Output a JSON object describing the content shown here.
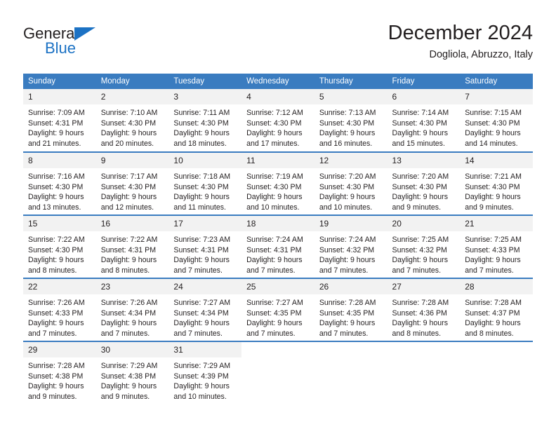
{
  "brand": {
    "name_part1": "General",
    "name_part2": "Blue",
    "accent_color": "#1c72c4"
  },
  "header": {
    "title": "December 2024",
    "subtitle": "Dogliola, Abruzzo, Italy",
    "header_bg_color": "#3a7cc0",
    "day_band_color": "#f2f2f2"
  },
  "weekdays": [
    "Sunday",
    "Monday",
    "Tuesday",
    "Wednesday",
    "Thursday",
    "Friday",
    "Saturday"
  ],
  "labels": {
    "sunrise_prefix": "Sunrise:",
    "sunset_prefix": "Sunset:",
    "daylight_prefix": "Daylight:"
  },
  "weeks": [
    [
      {
        "day": "1",
        "sunrise": "Sunrise: 7:09 AM",
        "sunset": "Sunset: 4:31 PM",
        "daylight_line1": "Daylight: 9 hours",
        "daylight_line2": "and 21 minutes."
      },
      {
        "day": "2",
        "sunrise": "Sunrise: 7:10 AM",
        "sunset": "Sunset: 4:30 PM",
        "daylight_line1": "Daylight: 9 hours",
        "daylight_line2": "and 20 minutes."
      },
      {
        "day": "3",
        "sunrise": "Sunrise: 7:11 AM",
        "sunset": "Sunset: 4:30 PM",
        "daylight_line1": "Daylight: 9 hours",
        "daylight_line2": "and 18 minutes."
      },
      {
        "day": "4",
        "sunrise": "Sunrise: 7:12 AM",
        "sunset": "Sunset: 4:30 PM",
        "daylight_line1": "Daylight: 9 hours",
        "daylight_line2": "and 17 minutes."
      },
      {
        "day": "5",
        "sunrise": "Sunrise: 7:13 AM",
        "sunset": "Sunset: 4:30 PM",
        "daylight_line1": "Daylight: 9 hours",
        "daylight_line2": "and 16 minutes."
      },
      {
        "day": "6",
        "sunrise": "Sunrise: 7:14 AM",
        "sunset": "Sunset: 4:30 PM",
        "daylight_line1": "Daylight: 9 hours",
        "daylight_line2": "and 15 minutes."
      },
      {
        "day": "7",
        "sunrise": "Sunrise: 7:15 AM",
        "sunset": "Sunset: 4:30 PM",
        "daylight_line1": "Daylight: 9 hours",
        "daylight_line2": "and 14 minutes."
      }
    ],
    [
      {
        "day": "8",
        "sunrise": "Sunrise: 7:16 AM",
        "sunset": "Sunset: 4:30 PM",
        "daylight_line1": "Daylight: 9 hours",
        "daylight_line2": "and 13 minutes."
      },
      {
        "day": "9",
        "sunrise": "Sunrise: 7:17 AM",
        "sunset": "Sunset: 4:30 PM",
        "daylight_line1": "Daylight: 9 hours",
        "daylight_line2": "and 12 minutes."
      },
      {
        "day": "10",
        "sunrise": "Sunrise: 7:18 AM",
        "sunset": "Sunset: 4:30 PM",
        "daylight_line1": "Daylight: 9 hours",
        "daylight_line2": "and 11 minutes."
      },
      {
        "day": "11",
        "sunrise": "Sunrise: 7:19 AM",
        "sunset": "Sunset: 4:30 PM",
        "daylight_line1": "Daylight: 9 hours",
        "daylight_line2": "and 10 minutes."
      },
      {
        "day": "12",
        "sunrise": "Sunrise: 7:20 AM",
        "sunset": "Sunset: 4:30 PM",
        "daylight_line1": "Daylight: 9 hours",
        "daylight_line2": "and 10 minutes."
      },
      {
        "day": "13",
        "sunrise": "Sunrise: 7:20 AM",
        "sunset": "Sunset: 4:30 PM",
        "daylight_line1": "Daylight: 9 hours",
        "daylight_line2": "and 9 minutes."
      },
      {
        "day": "14",
        "sunrise": "Sunrise: 7:21 AM",
        "sunset": "Sunset: 4:30 PM",
        "daylight_line1": "Daylight: 9 hours",
        "daylight_line2": "and 9 minutes."
      }
    ],
    [
      {
        "day": "15",
        "sunrise": "Sunrise: 7:22 AM",
        "sunset": "Sunset: 4:30 PM",
        "daylight_line1": "Daylight: 9 hours",
        "daylight_line2": "and 8 minutes."
      },
      {
        "day": "16",
        "sunrise": "Sunrise: 7:22 AM",
        "sunset": "Sunset: 4:31 PM",
        "daylight_line1": "Daylight: 9 hours",
        "daylight_line2": "and 8 minutes."
      },
      {
        "day": "17",
        "sunrise": "Sunrise: 7:23 AM",
        "sunset": "Sunset: 4:31 PM",
        "daylight_line1": "Daylight: 9 hours",
        "daylight_line2": "and 7 minutes."
      },
      {
        "day": "18",
        "sunrise": "Sunrise: 7:24 AM",
        "sunset": "Sunset: 4:31 PM",
        "daylight_line1": "Daylight: 9 hours",
        "daylight_line2": "and 7 minutes."
      },
      {
        "day": "19",
        "sunrise": "Sunrise: 7:24 AM",
        "sunset": "Sunset: 4:32 PM",
        "daylight_line1": "Daylight: 9 hours",
        "daylight_line2": "and 7 minutes."
      },
      {
        "day": "20",
        "sunrise": "Sunrise: 7:25 AM",
        "sunset": "Sunset: 4:32 PM",
        "daylight_line1": "Daylight: 9 hours",
        "daylight_line2": "and 7 minutes."
      },
      {
        "day": "21",
        "sunrise": "Sunrise: 7:25 AM",
        "sunset": "Sunset: 4:33 PM",
        "daylight_line1": "Daylight: 9 hours",
        "daylight_line2": "and 7 minutes."
      }
    ],
    [
      {
        "day": "22",
        "sunrise": "Sunrise: 7:26 AM",
        "sunset": "Sunset: 4:33 PM",
        "daylight_line1": "Daylight: 9 hours",
        "daylight_line2": "and 7 minutes."
      },
      {
        "day": "23",
        "sunrise": "Sunrise: 7:26 AM",
        "sunset": "Sunset: 4:34 PM",
        "daylight_line1": "Daylight: 9 hours",
        "daylight_line2": "and 7 minutes."
      },
      {
        "day": "24",
        "sunrise": "Sunrise: 7:27 AM",
        "sunset": "Sunset: 4:34 PM",
        "daylight_line1": "Daylight: 9 hours",
        "daylight_line2": "and 7 minutes."
      },
      {
        "day": "25",
        "sunrise": "Sunrise: 7:27 AM",
        "sunset": "Sunset: 4:35 PM",
        "daylight_line1": "Daylight: 9 hours",
        "daylight_line2": "and 7 minutes."
      },
      {
        "day": "26",
        "sunrise": "Sunrise: 7:28 AM",
        "sunset": "Sunset: 4:35 PM",
        "daylight_line1": "Daylight: 9 hours",
        "daylight_line2": "and 7 minutes."
      },
      {
        "day": "27",
        "sunrise": "Sunrise: 7:28 AM",
        "sunset": "Sunset: 4:36 PM",
        "daylight_line1": "Daylight: 9 hours",
        "daylight_line2": "and 8 minutes."
      },
      {
        "day": "28",
        "sunrise": "Sunrise: 7:28 AM",
        "sunset": "Sunset: 4:37 PM",
        "daylight_line1": "Daylight: 9 hours",
        "daylight_line2": "and 8 minutes."
      }
    ],
    [
      {
        "day": "29",
        "sunrise": "Sunrise: 7:28 AM",
        "sunset": "Sunset: 4:38 PM",
        "daylight_line1": "Daylight: 9 hours",
        "daylight_line2": "and 9 minutes."
      },
      {
        "day": "30",
        "sunrise": "Sunrise: 7:29 AM",
        "sunset": "Sunset: 4:38 PM",
        "daylight_line1": "Daylight: 9 hours",
        "daylight_line2": "and 9 minutes."
      },
      {
        "day": "31",
        "sunrise": "Sunrise: 7:29 AM",
        "sunset": "Sunset: 4:39 PM",
        "daylight_line1": "Daylight: 9 hours",
        "daylight_line2": "and 10 minutes."
      },
      {
        "day": "",
        "sunrise": "",
        "sunset": "",
        "daylight_line1": "",
        "daylight_line2": ""
      },
      {
        "day": "",
        "sunrise": "",
        "sunset": "",
        "daylight_line1": "",
        "daylight_line2": ""
      },
      {
        "day": "",
        "sunrise": "",
        "sunset": "",
        "daylight_line1": "",
        "daylight_line2": ""
      },
      {
        "day": "",
        "sunrise": "",
        "sunset": "",
        "daylight_line1": "",
        "daylight_line2": ""
      }
    ]
  ]
}
